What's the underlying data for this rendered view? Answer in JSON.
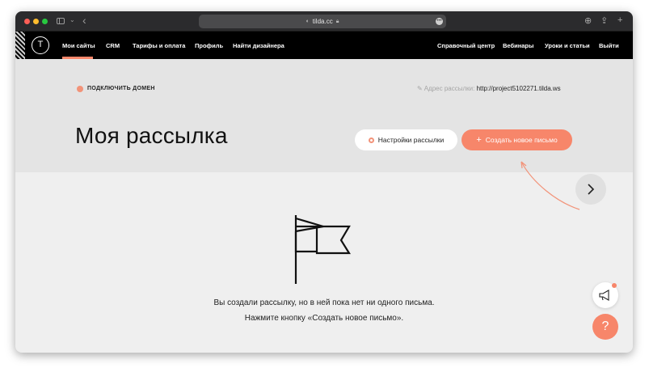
{
  "browser": {
    "url": "tilda.cc",
    "colors": {
      "toolbar": "#2b2b2d",
      "address_bar": "#4a4a4c"
    }
  },
  "topnav": {
    "left_items": [
      {
        "label": "Мои сайты",
        "active": true
      },
      {
        "label": "CRM"
      },
      {
        "label": "Тарифы и оплата"
      },
      {
        "label": "Профиль"
      },
      {
        "label": "Найти дизайнера"
      }
    ],
    "right_items": [
      {
        "label": "Справочный центр"
      },
      {
        "label": "Вебинары"
      },
      {
        "label": "Уроки и статьи"
      },
      {
        "label": "Выйти"
      }
    ],
    "logo_letter": "T",
    "accent": "#fa876b"
  },
  "header": {
    "connect_domain": "ПОДКЛЮЧИТЬ ДОМЕН",
    "mail_address_label": "Адрес рассылки:",
    "mail_address_value": "http://project5102271.tilda.ws",
    "title": "Моя рассылка",
    "settings_button": "Настройки рассылки",
    "create_button": "Создать новое письмо",
    "create_button_icon": "+"
  },
  "empty_state": {
    "icon": "flag-icon",
    "line1": "Вы создали рассылку, но в ней пока нет ни одного письма.",
    "line2": "Нажмите кнопку «Создать новое письмо»."
  },
  "widgets": {
    "help_label": "?",
    "promo_icon": "megaphone-icon",
    "next_icon": "chevron-right-icon"
  }
}
